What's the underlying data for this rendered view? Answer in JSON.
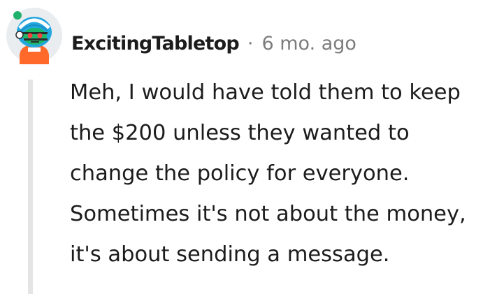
{
  "comment": {
    "author": "ExcitingTabletop",
    "separator": "·",
    "timestamp": "6 mo. ago",
    "body": "Meh, I would have told them to keep the $200 unless they wanted to change the policy for everyone. Sometimes it's not about the money, it's about sending a message.",
    "avatar_icon": "snoo-avatar-icon",
    "thread_line_color": "#e5e5e5",
    "meta_color": "#7c7c7c",
    "text_color": "#1c1c1c"
  }
}
